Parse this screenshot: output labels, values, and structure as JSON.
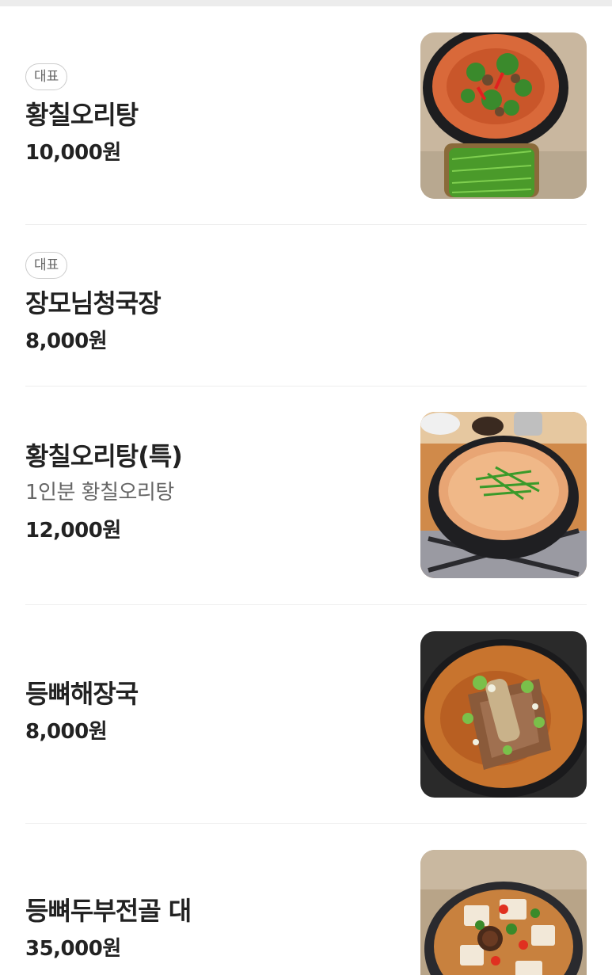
{
  "menu": {
    "items": [
      {
        "badge": "대표",
        "name": "황칠오리탕",
        "description": "",
        "price": "10,000원",
        "photo_icon": "duck-soup-photo"
      },
      {
        "badge": "대표",
        "name": "장모님청국장",
        "description": "",
        "price": "8,000원",
        "photo_icon": ""
      },
      {
        "badge": "",
        "name": "황칠오리탕(특)",
        "description": "1인분 황칠오리탕",
        "price": "12,000원",
        "photo_icon": "duck-soup-pot-photo"
      },
      {
        "badge": "",
        "name": "등뼈해장국",
        "description": "",
        "price": "8,000원",
        "photo_icon": "pork-bone-soup-photo"
      },
      {
        "badge": "",
        "name": "등뼈두부전골 대",
        "description": "",
        "price": "35,000원",
        "photo_icon": "tofu-hotpot-photo"
      }
    ]
  }
}
